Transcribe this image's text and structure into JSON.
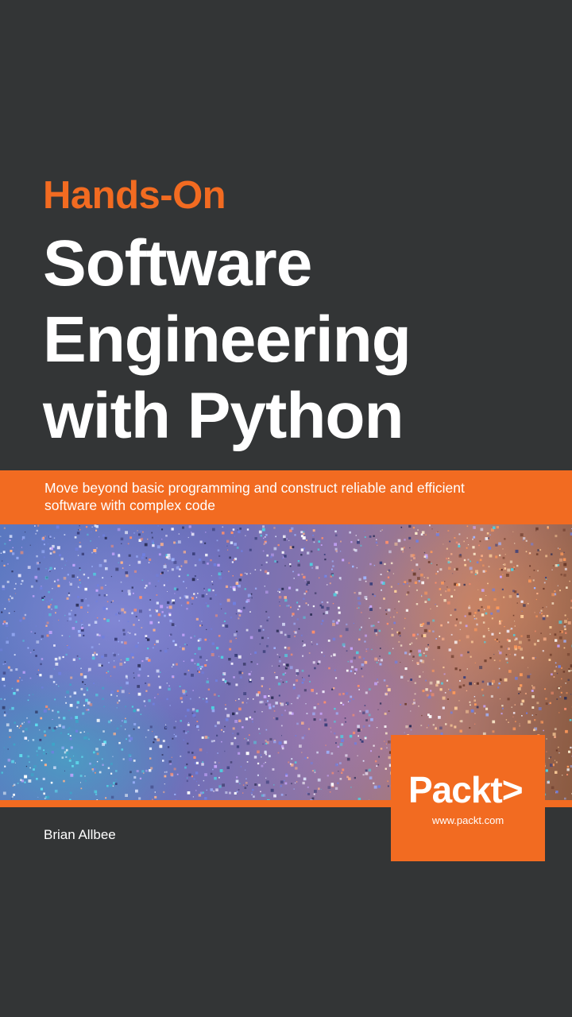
{
  "book": {
    "series": "Hands-On",
    "title_lines": [
      "Software",
      "Engineering",
      "with Python"
    ],
    "subtitle_line1": "Move beyond basic programming and construct reliable and efficient",
    "subtitle_line2": "software with complex code",
    "author": "Brian Allbee"
  },
  "publisher": {
    "logo_text": "Packt>",
    "url": "www.packt.com"
  },
  "colors": {
    "background": "#333536",
    "accent": "#f26b21",
    "text": "#ffffff"
  }
}
